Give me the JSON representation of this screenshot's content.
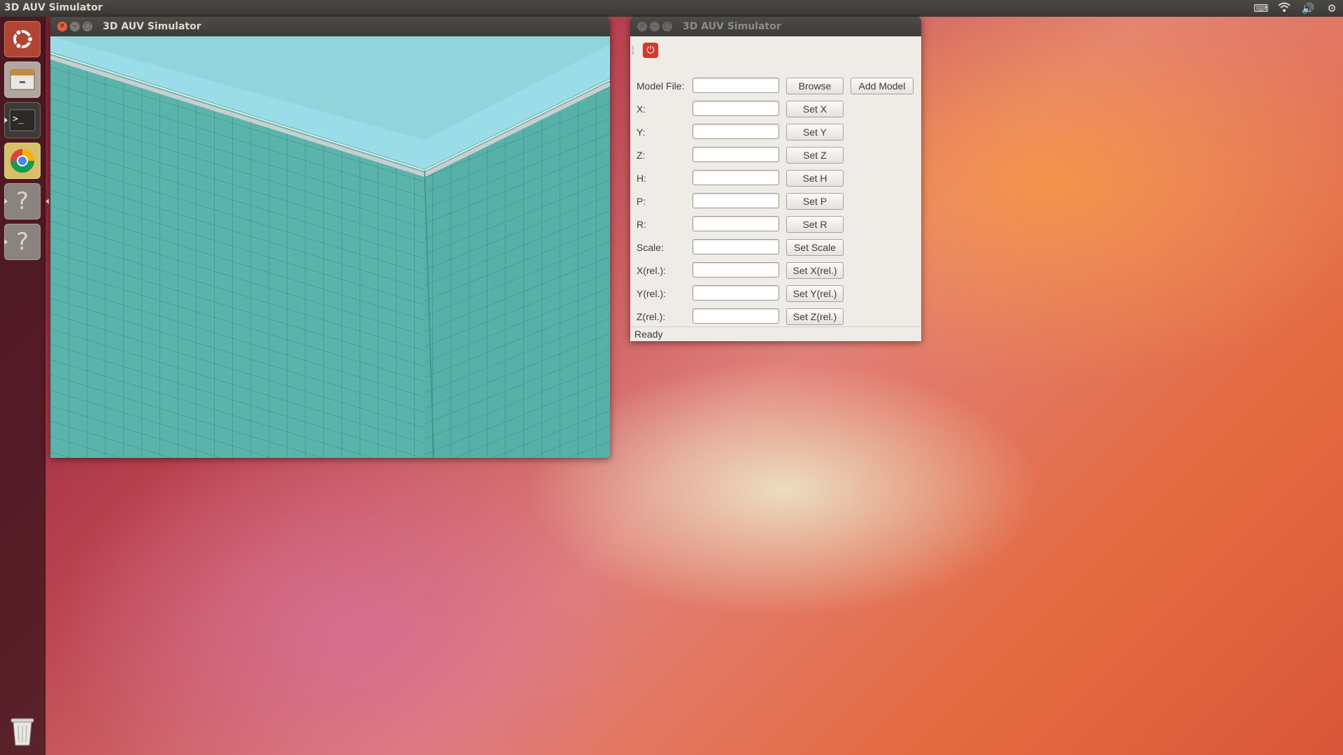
{
  "top_panel": {
    "title": "3D AUV Simulator",
    "tray_icons": [
      "keyboard-icon",
      "wifi-icon",
      "volume-icon",
      "settings-gear-icon"
    ]
  },
  "launcher": {
    "items": [
      {
        "name": "dash-home",
        "icon": "ubuntu-logo-icon"
      },
      {
        "name": "files",
        "icon": "file-cabinet-icon"
      },
      {
        "name": "terminal",
        "icon": "terminal-icon"
      },
      {
        "name": "chrome",
        "icon": "chrome-icon"
      },
      {
        "name": "unknown-app-1",
        "icon": "question-mark-icon",
        "label": "?"
      },
      {
        "name": "unknown-app-2",
        "icon": "question-mark-icon",
        "label": "?"
      },
      {
        "name": "trash",
        "icon": "trash-icon"
      }
    ]
  },
  "view_window": {
    "title": "3D AUV Simulator"
  },
  "control_window": {
    "title": "3D AUV Simulator",
    "power_icon": "power-icon",
    "model_file": {
      "label": "Model File:",
      "value": "",
      "browse": "Browse",
      "add": "Add Model"
    },
    "rows": [
      {
        "label": "X:",
        "value": "",
        "button": "Set X"
      },
      {
        "label": "Y:",
        "value": "",
        "button": "Set Y"
      },
      {
        "label": "Z:",
        "value": "",
        "button": "Set Z"
      },
      {
        "label": "H:",
        "value": "",
        "button": "Set H"
      },
      {
        "label": "P:",
        "value": "",
        "button": "Set P"
      },
      {
        "label": "R:",
        "value": "",
        "button": "Set R"
      },
      {
        "label": "Scale:",
        "value": "",
        "button": "Set Scale"
      },
      {
        "label": "X(rel.):",
        "value": "",
        "button": "Set X(rel.)"
      },
      {
        "label": "Y(rel.):",
        "value": "",
        "button": "Set Y(rel.)"
      },
      {
        "label": "Z(rel.):",
        "value": "",
        "button": "Set Z(rel.)"
      }
    ],
    "status": "Ready"
  },
  "colors": {
    "water_wall": "#57b2a9",
    "sky": "#9adce8",
    "accent_close": "#e8603a",
    "power_red": "#d23a2c"
  }
}
